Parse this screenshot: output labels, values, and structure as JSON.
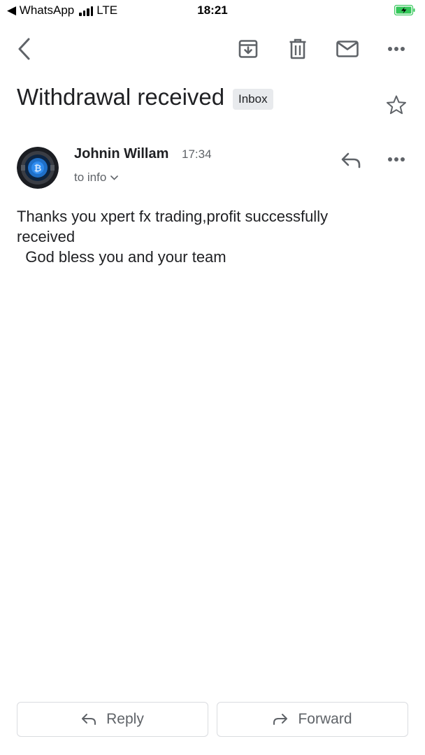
{
  "status_bar": {
    "back_app": "◀ WhatsApp",
    "carrier": "LTE",
    "time": "18:21"
  },
  "toolbar": {
    "icons": [
      "back-arrow-icon",
      "archive-icon",
      "trash-icon",
      "mail-icon",
      "more-icon"
    ]
  },
  "email": {
    "subject": "Withdrawal received",
    "label": "Inbox",
    "sender": "Johnin Willam",
    "time": "17:34",
    "recipient": "to info",
    "body": [
      "Thanks you xpert fx trading,profit successfully",
      "received",
      "  God bless you and your team"
    ]
  },
  "actions": {
    "reply_label": "Reply",
    "forward_label": "Forward"
  },
  "colors": {
    "text": "#202124",
    "secondary": "#5f6368",
    "chip": "#e8eaed",
    "battery": "#34c759"
  }
}
